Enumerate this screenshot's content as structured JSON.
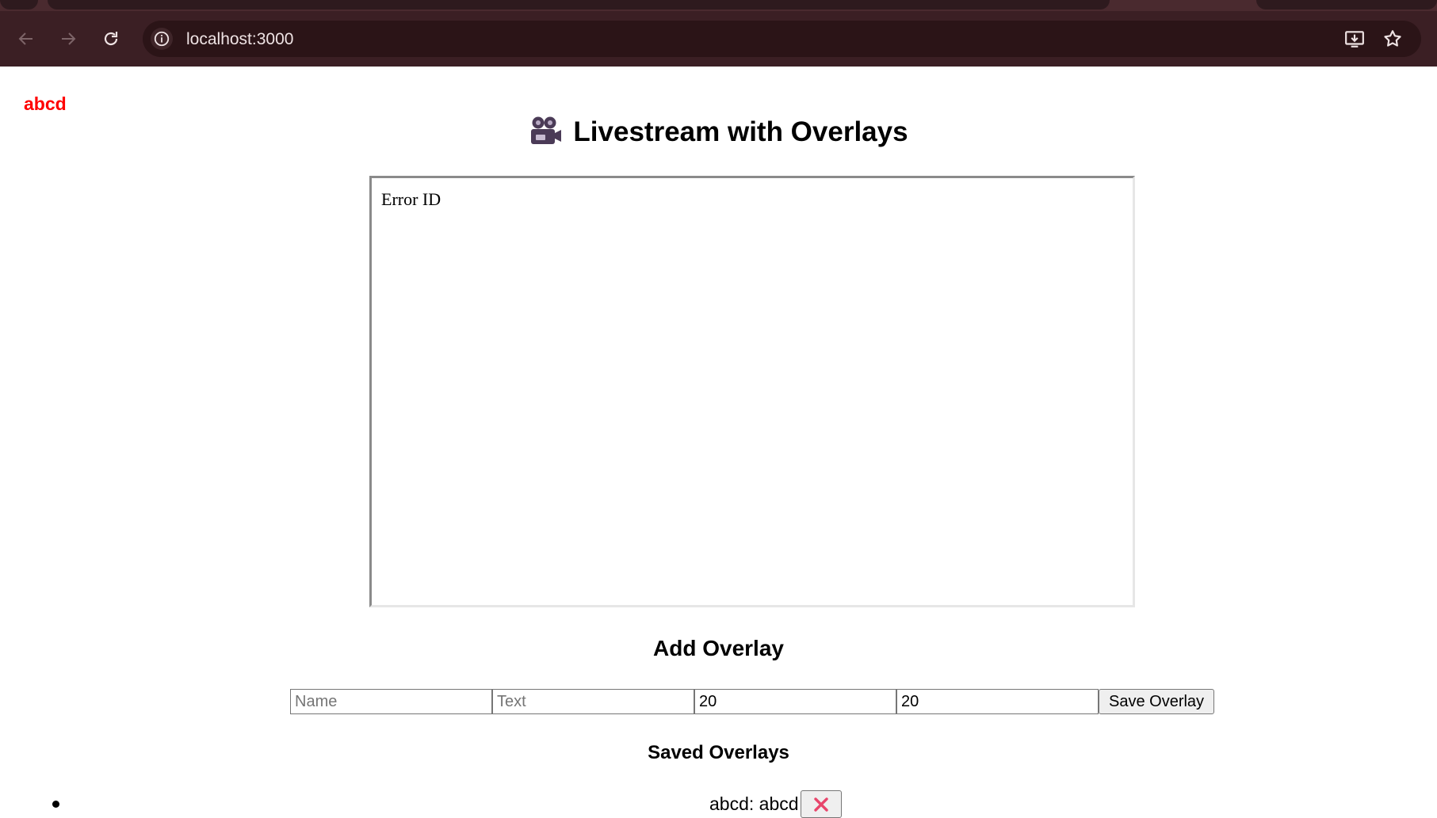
{
  "browser": {
    "url": "localhost:3000"
  },
  "page": {
    "brand": "abcd",
    "title": "Livestream with Overlays",
    "title_icon": "movie-camera-icon",
    "video_message": "Error ID",
    "add_overlay": {
      "heading": "Add Overlay",
      "name_placeholder": "Name",
      "text_placeholder": "Text",
      "x_value": "20",
      "y_value": "20",
      "save_label": "Save Overlay"
    },
    "saved_overlays": {
      "heading": "Saved Overlays",
      "items": [
        {
          "text": "abcd: abcd",
          "delete_icon": "red-x-icon"
        }
      ]
    }
  },
  "colors": {
    "brand": "#ff0000",
    "chrome_toolbar": "#3b1f24",
    "chrome_omnibox": "#2b1417",
    "delete_x": "#e8456b"
  }
}
